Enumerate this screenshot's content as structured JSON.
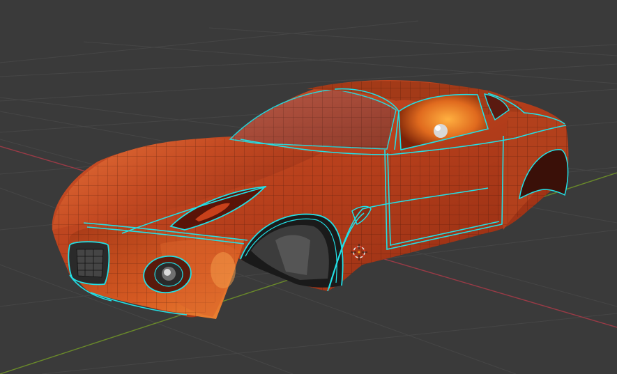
{
  "viewport": {
    "mode": "edit-mode-3d-viewport",
    "object": "car-body-mesh",
    "colors": {
      "background": "#3a3a3a",
      "grid": "#464646",
      "x_axis": "#9a3a46",
      "y_axis": "#6a8a2a",
      "body_dark": "#6e1a0c",
      "body_mid": "#b8401c",
      "body_light": "#e2662c",
      "highlight": "#f49a48",
      "wire": "#1a0a04",
      "selection": "#22e0e6",
      "cursor_ring": "#e0e0e0",
      "cursor_red": "#e03a2a"
    }
  }
}
